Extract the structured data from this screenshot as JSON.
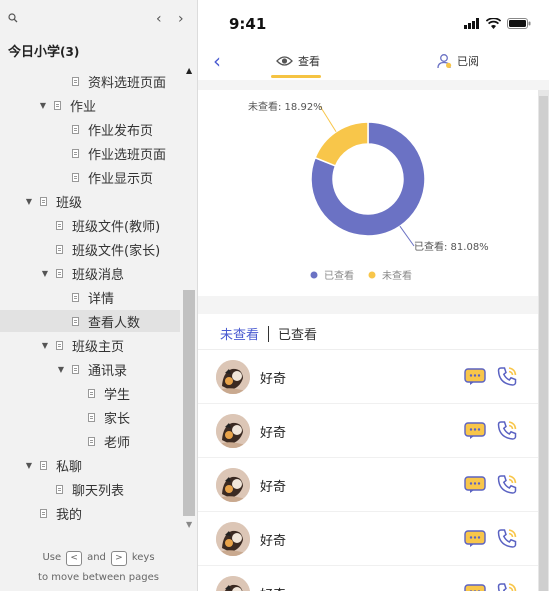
{
  "sidebar": {
    "project_name": "今日小学",
    "project_count": "(3)",
    "tree": [
      {
        "label": "资料选班页面",
        "twisty": "",
        "active": false
      },
      {
        "label": "作业",
        "twisty": "▼",
        "active": false
      },
      {
        "label": "作业发布页",
        "twisty": "",
        "active": false
      },
      {
        "label": "作业选班页面",
        "twisty": "",
        "active": false
      },
      {
        "label": "作业显示页",
        "twisty": "",
        "active": false
      },
      {
        "label": "班级",
        "twisty": "▼",
        "active": false
      },
      {
        "label": "班级文件(教师)",
        "twisty": "",
        "active": false
      },
      {
        "label": "班级文件(家长)",
        "twisty": "",
        "active": false
      },
      {
        "label": "班级消息",
        "twisty": "▼",
        "active": false
      },
      {
        "label": "详情",
        "twisty": "",
        "active": false
      },
      {
        "label": "查看人数",
        "twisty": "",
        "active": true
      },
      {
        "label": "班级主页",
        "twisty": "▼",
        "active": false
      },
      {
        "label": "通讯录",
        "twisty": "▼",
        "active": false
      },
      {
        "label": "学生",
        "twisty": "",
        "active": false
      },
      {
        "label": "家长",
        "twisty": "",
        "active": false
      },
      {
        "label": "老师",
        "twisty": "",
        "active": false
      },
      {
        "label": "私聊",
        "twisty": "▼",
        "active": false
      },
      {
        "label": "聊天列表",
        "twisty": "",
        "active": false
      },
      {
        "label": "我的",
        "twisty": "",
        "active": false
      }
    ],
    "hint_use": "Use",
    "hint_and": "and",
    "hint_keys": "keys",
    "hint_line2": "to move between pages",
    "key_prev": "<",
    "key_next": ">"
  },
  "phone": {
    "status_time": "9:41",
    "tab_look": "查看",
    "tab_read": "已阅",
    "list_tab_unviewed": "未查看",
    "list_tab_viewed": "已查看",
    "rows": [
      {
        "name": "好奇"
      },
      {
        "name": "好奇"
      },
      {
        "name": "好奇"
      },
      {
        "name": "好奇"
      },
      {
        "name": "好奇"
      }
    ]
  },
  "chart_data": {
    "type": "pie",
    "categories": [
      "已查看",
      "未查看"
    ],
    "values": [
      81.08,
      18.92
    ],
    "data_labels": [
      "已查看: 81.08%",
      "未查看: 18.92%"
    ],
    "colors": [
      "#6b72c4",
      "#f8c64a"
    ],
    "legend": [
      "已查看",
      "未查看"
    ],
    "legend_position": "bottom"
  }
}
